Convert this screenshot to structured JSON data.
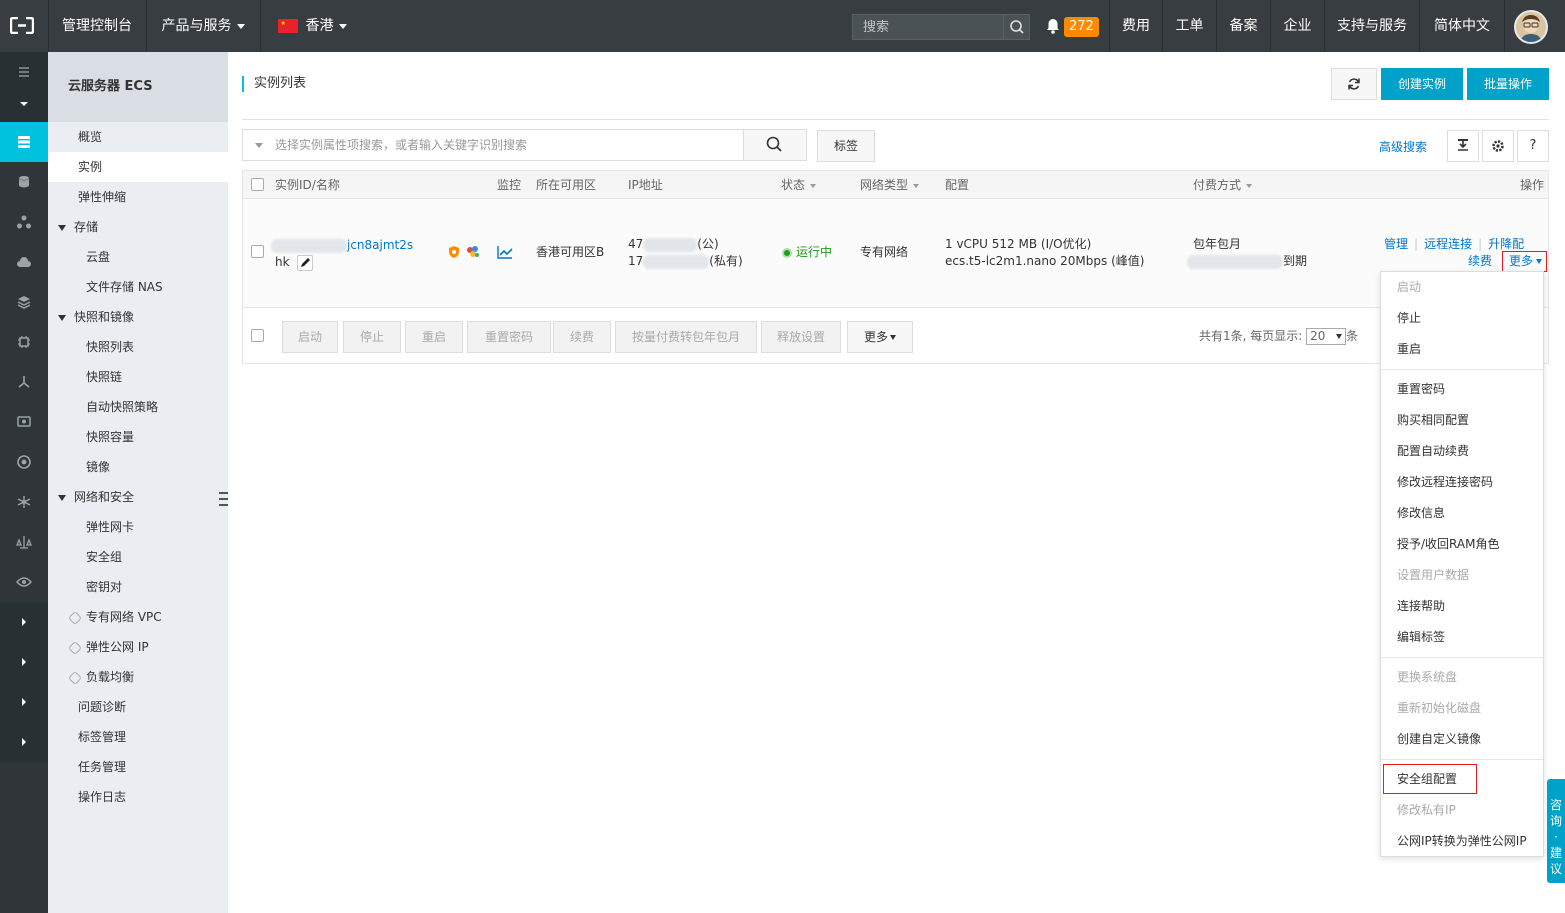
{
  "topbar": {
    "console": "管理控制台",
    "products": "产品与服务",
    "region": "香港",
    "search_placeholder": "搜索",
    "notification_count": "272",
    "links": [
      "费用",
      "工单",
      "备案",
      "企业",
      "支持与服务",
      "简体中文"
    ]
  },
  "sidebar": {
    "title": "云服务器 ECS",
    "items": [
      {
        "label": "概览"
      },
      {
        "label": "实例"
      },
      {
        "label": "弹性伸缩"
      },
      {
        "label": "存储"
      },
      {
        "label": "云盘"
      },
      {
        "label": "文件存储 NAS"
      },
      {
        "label": "快照和镜像"
      },
      {
        "label": "快照列表"
      },
      {
        "label": "快照链"
      },
      {
        "label": "自动快照策略"
      },
      {
        "label": "快照容量"
      },
      {
        "label": "镜像"
      },
      {
        "label": "网络和安全"
      },
      {
        "label": "弹性网卡"
      },
      {
        "label": "安全组"
      },
      {
        "label": "密钥对"
      },
      {
        "label": "专有网络 VPC"
      },
      {
        "label": "弹性公网 IP"
      },
      {
        "label": "负载均衡"
      },
      {
        "label": "问题诊断"
      },
      {
        "label": "标签管理"
      },
      {
        "label": "任务管理"
      },
      {
        "label": "操作日志"
      }
    ]
  },
  "main": {
    "title": "实例列表",
    "create_btn": "创建实例",
    "batch_btn": "批量操作",
    "filter_placeholder": "选择实例属性项搜索，或者输入关键字识别搜索",
    "tag_btn": "标签",
    "advanced_search": "高级搜索",
    "help_btn": "?"
  },
  "table": {
    "headers": [
      "实例ID/名称",
      "监控",
      "所在可用区",
      "IP地址",
      "状态",
      "网络类型",
      "配置",
      "付费方式",
      "操作"
    ],
    "row": {
      "id_suffix": "jcn8ajmt2s",
      "name": "hk",
      "zone": "香港可用区B",
      "ip_public_prefix": "47",
      "ip_public_tag": "(公)",
      "ip_private_prefix": "17",
      "ip_private_tag": "(私有)",
      "status": "运行中",
      "network": "专有网络",
      "config_line1": "1 vCPU 512 MB (I/O优化)",
      "config_line2": "ecs.t5-lc2m1.nano   20Mbps (峰值)",
      "billing": "包年包月",
      "expire_suffix": "到期",
      "ops": {
        "manage": "管理",
        "remote": "远程连接",
        "upgrade": "升降配",
        "renew": "续费",
        "more": "更多"
      }
    },
    "footer_buttons": [
      "启动",
      "停止",
      "重启",
      "重置密码",
      "续费",
      "按量付费转包年包月",
      "释放设置",
      "更多"
    ],
    "pager_text": "共有1条, 每页显示:",
    "page_size": "20",
    "pager_unit": "条"
  },
  "dropdown": {
    "items": [
      {
        "label": "启动",
        "disabled": true
      },
      {
        "label": "停止",
        "disabled": false
      },
      {
        "label": "重启",
        "disabled": false
      },
      {
        "label": "重置密码",
        "disabled": false
      },
      {
        "label": "购买相同配置",
        "disabled": false
      },
      {
        "label": "配置自动续费",
        "disabled": false
      },
      {
        "label": "修改远程连接密码",
        "disabled": false
      },
      {
        "label": "修改信息",
        "disabled": false
      },
      {
        "label": "授予/收回RAM角色",
        "disabled": false
      },
      {
        "label": "设置用户数据",
        "disabled": true
      },
      {
        "label": "连接帮助",
        "disabled": false
      },
      {
        "label": "编辑标签",
        "disabled": false
      },
      {
        "label": "更换系统盘",
        "disabled": true
      },
      {
        "label": "重新初始化磁盘",
        "disabled": true
      },
      {
        "label": "创建自定义镜像",
        "disabled": false
      },
      {
        "label": "安全组配置",
        "disabled": false
      },
      {
        "label": "修改私有IP",
        "disabled": true
      },
      {
        "label": "公网IP转换为弹性公网IP",
        "disabled": false
      }
    ]
  },
  "feedback": "咨询·建议",
  "colors": {
    "topbar": "#373d41",
    "rail": "#2f3538",
    "accent": "#00c1de",
    "primary_btn": "#00a2ca",
    "link": "#0077cc",
    "status_ok": "#1e9d1e",
    "badge": "#ff8a00",
    "highlight_border": "#e02020"
  }
}
